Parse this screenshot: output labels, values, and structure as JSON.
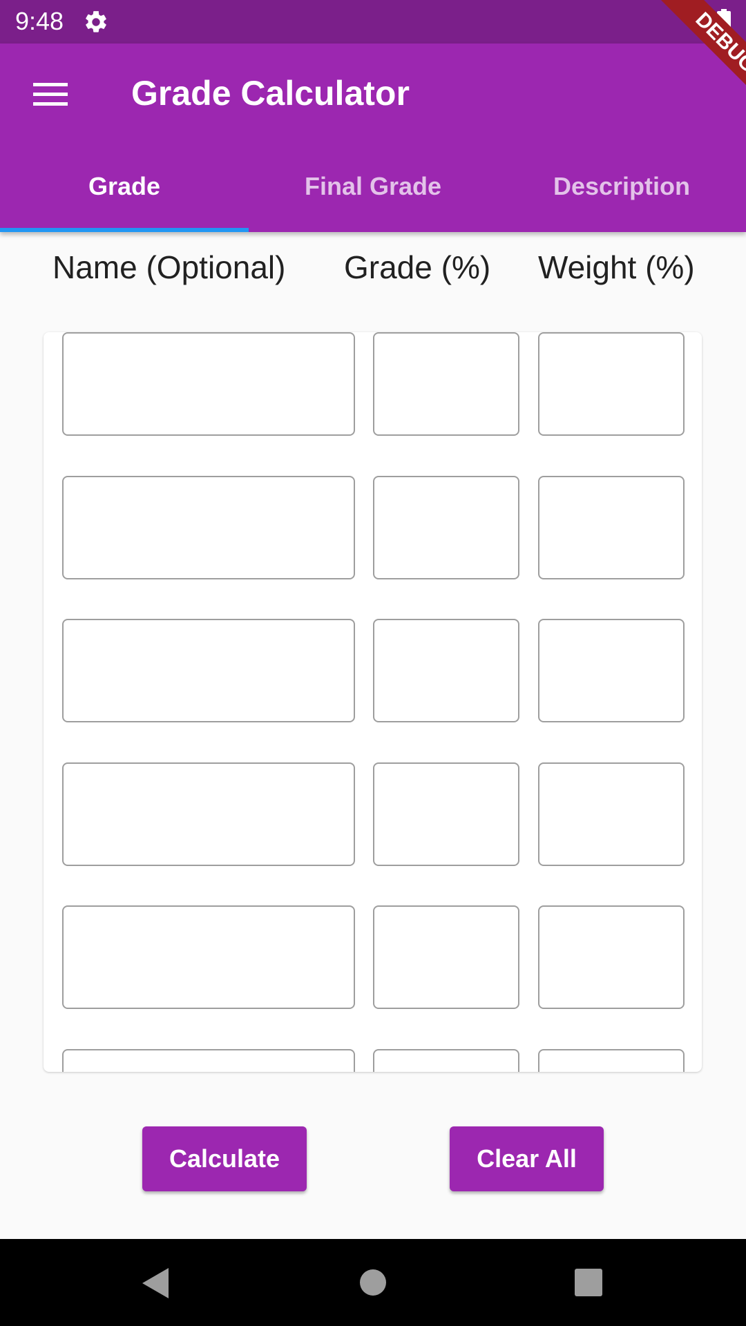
{
  "status_bar": {
    "time": "9:48",
    "settings_icon": "gear-icon",
    "battery_icon": "battery-icon"
  },
  "debug_banner": {
    "label": "DEBUG"
  },
  "app_bar": {
    "title": "Grade Calculator",
    "menu_icon": "menu-icon"
  },
  "tabs": [
    {
      "label": "Grade",
      "active": true
    },
    {
      "label": "Final Grade",
      "active": false
    },
    {
      "label": "Description",
      "active": false
    }
  ],
  "columns": {
    "name": "Name (Optional)",
    "grade": "Grade (%)",
    "weight": "Weight (%)"
  },
  "rows": [
    {
      "name": "",
      "grade": "",
      "weight": ""
    },
    {
      "name": "",
      "grade": "",
      "weight": ""
    },
    {
      "name": "",
      "grade": "",
      "weight": ""
    },
    {
      "name": "",
      "grade": "",
      "weight": ""
    },
    {
      "name": "",
      "grade": "",
      "weight": ""
    },
    {
      "name": "",
      "grade": "",
      "weight": ""
    }
  ],
  "buttons": {
    "calculate": "Calculate",
    "clear_all": "Clear All"
  },
  "nav_bar": {
    "back_icon": "back-icon",
    "home_icon": "home-icon",
    "recents_icon": "recents-icon"
  },
  "colors": {
    "primary": "#9c27b0",
    "status_bar": "#7b1f8a",
    "indicator": "#2196f3"
  }
}
